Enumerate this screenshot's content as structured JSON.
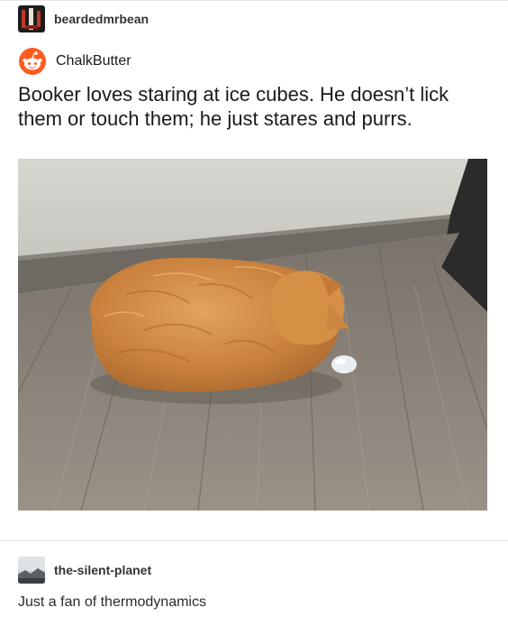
{
  "reblog": {
    "username": "beardedmrbean"
  },
  "reddit": {
    "username": "ChalkButter",
    "post_text": "Booker loves staring at ice cubes. He doesn’t lick them or touch them; he just stares and purrs."
  },
  "reply": {
    "username": "the-silent-planet",
    "text": "Just a fan of thermodynamics"
  }
}
